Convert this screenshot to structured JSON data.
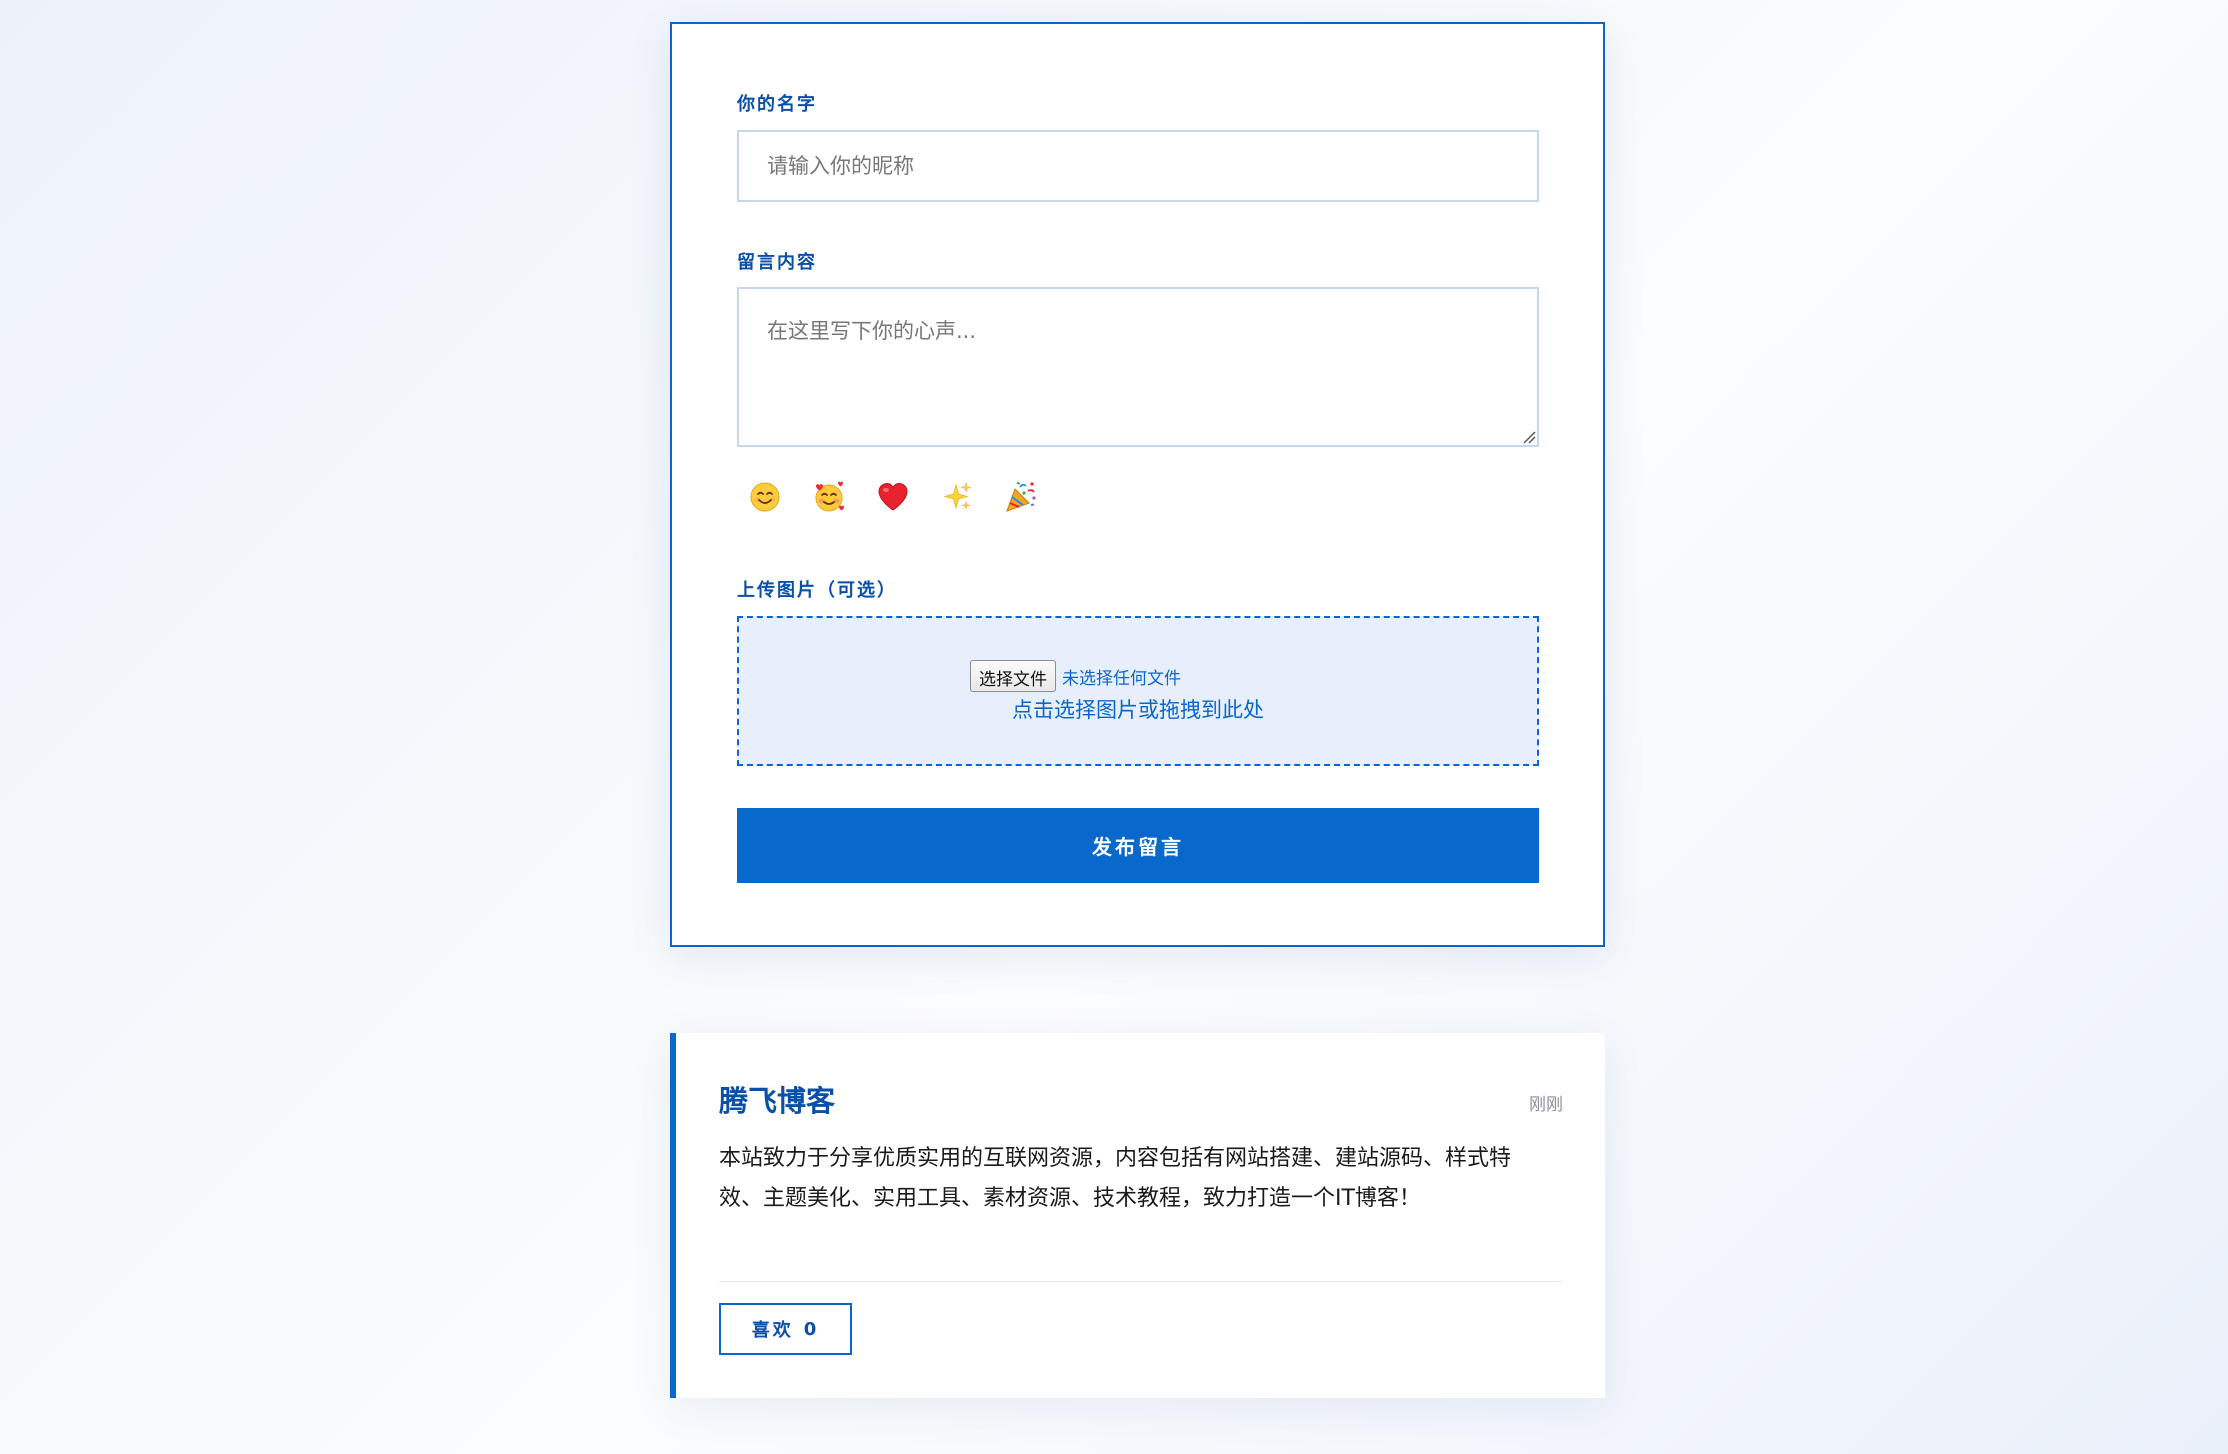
{
  "form": {
    "name_label": "你的名字",
    "name_placeholder": "请输入你的昵称",
    "message_label": "留言内容",
    "message_placeholder": "在这里写下你的心声...",
    "emojis": [
      {
        "name": "smiling-face-icon",
        "char": "😊"
      },
      {
        "name": "smiling-face-hearts-icon",
        "char": "🥰"
      },
      {
        "name": "red-heart-icon",
        "char": "❤️"
      },
      {
        "name": "sparkles-icon",
        "char": "✨"
      },
      {
        "name": "party-popper-icon",
        "char": "🎉"
      }
    ],
    "upload_label": "上传图片（可选）",
    "file_button_label": "选择文件",
    "file_status": "未选择任何文件",
    "upload_hint": "点击选择图片或拖拽到此处",
    "submit_label": "发布留言"
  },
  "comment": {
    "author": "腾飞博客",
    "time": "刚刚",
    "text": "本站致力于分享优质实用的互联网资源，内容包括有网站搭建、建站源码、样式特效、主题美化、实用工具、素材资源、技术教程，致力打造一个IT博客！",
    "like_label": "喜欢",
    "like_count": "0"
  },
  "colors": {
    "accent": "#0968cc",
    "label": "#0a4fa8",
    "upload_bg": "#e6effb"
  }
}
